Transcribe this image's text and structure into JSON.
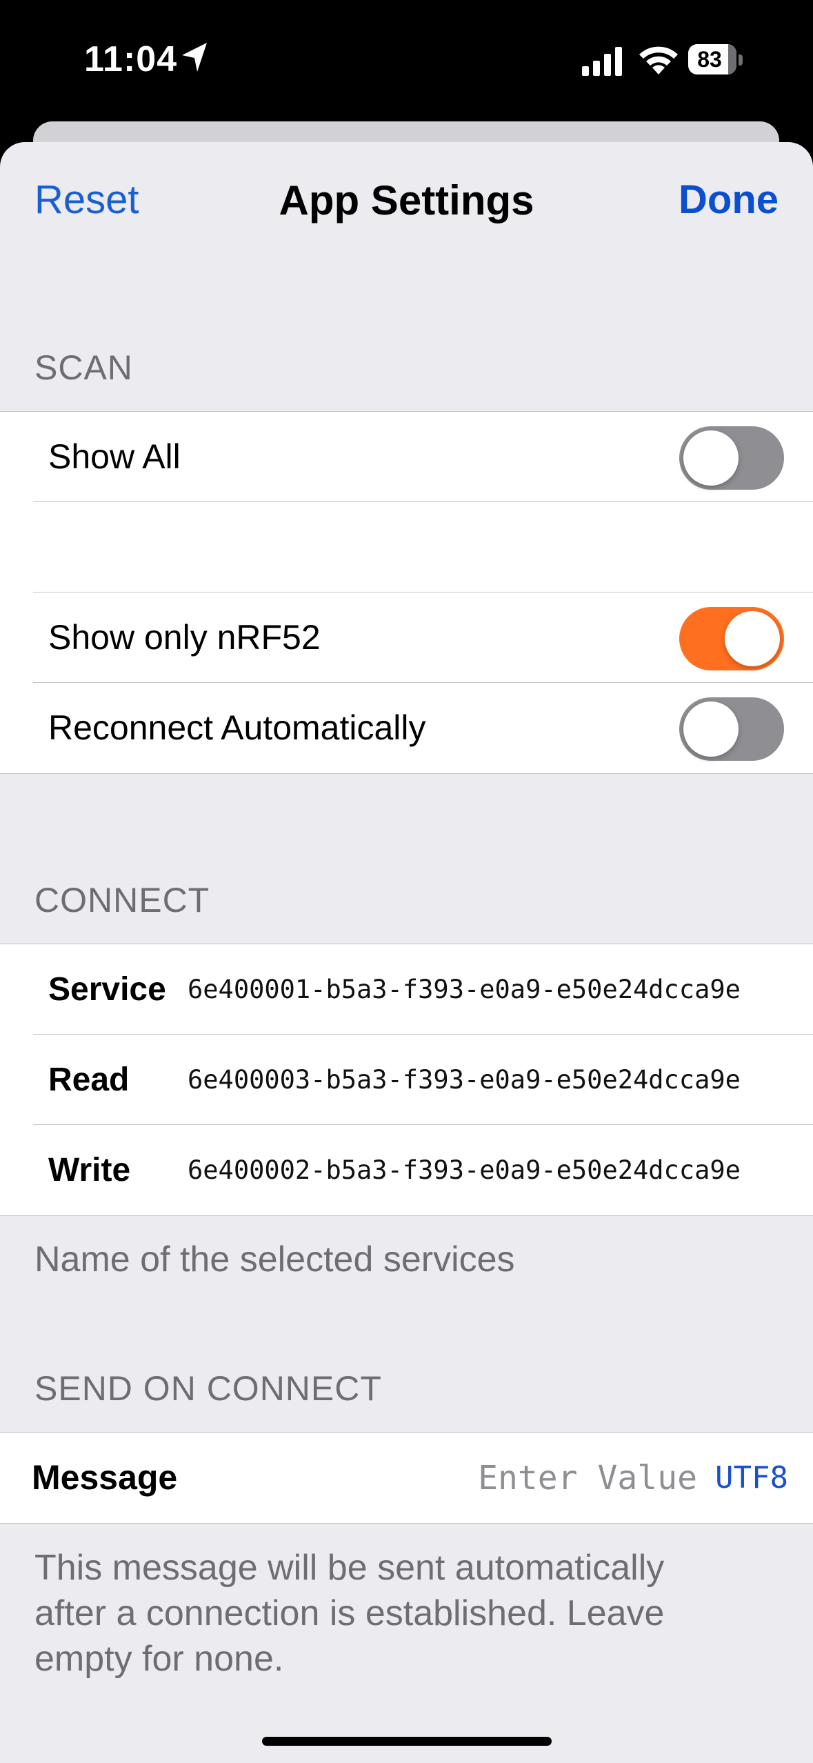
{
  "status_bar": {
    "time": "11:04",
    "battery": "83"
  },
  "nav": {
    "reset_label": "Reset",
    "title": "App Settings",
    "done_label": "Done"
  },
  "scan": {
    "header": "SCAN",
    "show_all": {
      "label": "Show All",
      "on": false
    },
    "show_only": {
      "label": "Show only nRF52",
      "on": true
    },
    "reconnect": {
      "label": "Reconnect Automatically",
      "on": false
    }
  },
  "connect": {
    "header": "CONNECT",
    "rows": [
      {
        "label": "Service",
        "value": "6e400001-b5a3-f393-e0a9-e50e24dcca9e"
      },
      {
        "label": "Read",
        "value": "6e400003-b5a3-f393-e0a9-e50e24dcca9e"
      },
      {
        "label": "Write",
        "value": "6e400002-b5a3-f393-e0a9-e50e24dcca9e"
      }
    ],
    "footer": "Name of the selected services"
  },
  "send_on_connect": {
    "header": "SEND ON CONNECT",
    "message_label": "Message",
    "message_placeholder": "Enter Value",
    "message_value": "",
    "encoding": "UTF8",
    "footer_lines": [
      "This message will be sent automatically",
      "after a connection is established. Leave",
      "empty for none."
    ]
  },
  "colors": {
    "accent": "#1a5fd1",
    "toggle_on": "#ff6f1f",
    "toggle_off": "#8e8e93",
    "grouped_background": "#ebebf0"
  },
  "icons": [
    "location-arrow-icon",
    "cellular-signal-icon",
    "wifi-icon",
    "battery-icon"
  ]
}
